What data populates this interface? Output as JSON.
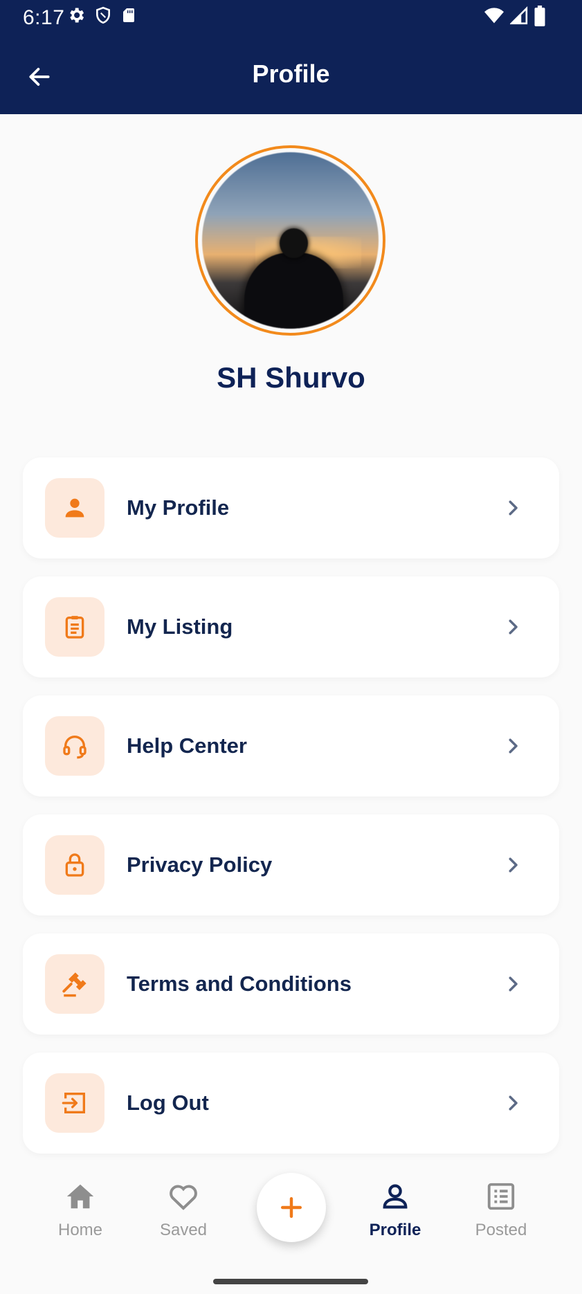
{
  "status_bar": {
    "time": "6:17",
    "icons": [
      "gear-icon",
      "shield-icon",
      "sd-card-icon",
      "wifi-icon",
      "signal-icon",
      "battery-icon"
    ]
  },
  "app_bar": {
    "title": "Profile",
    "back_icon": "arrow-left-icon"
  },
  "profile": {
    "name": "SH Shurvo"
  },
  "menu": [
    {
      "label": "My Profile",
      "icon": "person-icon"
    },
    {
      "label": "My Listing",
      "icon": "clipboard-icon"
    },
    {
      "label": "Help Center",
      "icon": "headset-icon"
    },
    {
      "label": "Privacy Policy",
      "icon": "lock-icon"
    },
    {
      "label": "Terms and Conditions",
      "icon": "gavel-icon"
    },
    {
      "label": "Log Out",
      "icon": "logout-icon"
    }
  ],
  "bottom_nav": {
    "items": [
      {
        "label": "Home",
        "icon": "home-icon",
        "active": false
      },
      {
        "label": "Saved",
        "icon": "heart-icon",
        "active": false
      },
      {
        "label": "Profile",
        "icon": "person-outline-icon",
        "active": true
      },
      {
        "label": "Posted",
        "icon": "list-icon",
        "active": false
      }
    ],
    "fab_icon": "plus-icon"
  },
  "colors": {
    "primary": "#0e2257",
    "accent": "#f28a1c",
    "icon_bg": "#fde9dc",
    "background": "#fafafa",
    "inactive": "#9a9a9a"
  }
}
